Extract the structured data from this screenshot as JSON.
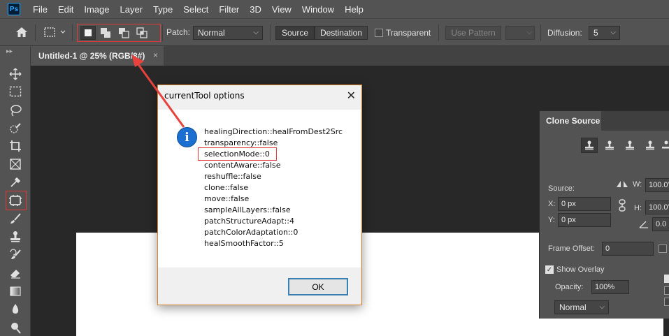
{
  "app": {
    "logo_text": "Ps"
  },
  "menu": [
    "File",
    "Edit",
    "Image",
    "Layer",
    "Type",
    "Select",
    "Filter",
    "3D",
    "View",
    "Window",
    "Help"
  ],
  "options_bar": {
    "patch_label": "Patch:",
    "patch_value": "Normal",
    "source_label": "Source",
    "destination_label": "Destination",
    "transparent_label": "Transparent",
    "transparent_checked": false,
    "use_pattern_label": "Use Pattern",
    "diffusion_label": "Diffusion:",
    "diffusion_value": "5",
    "active_selection_mode": "new-selection"
  },
  "document": {
    "tab_title": "Untitled-1 @ 25% (RGB/8#)",
    "close_glyph": "×"
  },
  "dialog": {
    "title": "currentTool options",
    "close_glyph": "✕",
    "icon_glyph": "i",
    "lines": [
      "healingDirection::healFromDest2Src",
      "transparency::false",
      "selectionMode::0",
      "contentAware::false",
      "reshuffle::false",
      "clone::false",
      "move::false",
      "sampleAllLayers::false",
      "patchStructureAdapt::4",
      "patchColorAdaptation::0",
      "healSmoothFactor::5"
    ],
    "ok_label": "OK"
  },
  "clone_panel": {
    "title": "Clone Source",
    "source_label": "Source:",
    "x_label": "X:",
    "x_value": "0 px",
    "y_label": "Y:",
    "y_value": "0 px",
    "w_label": "W:",
    "w_value": "100.0°",
    "h_label": "H:",
    "h_value": "100.0°",
    "angle_value": "0.0",
    "frame_offset_label": "Frame Offset:",
    "frame_offset_value": "0",
    "show_overlay_label": "Show Overlay",
    "show_overlay_checked": true,
    "opacity_label": "Opacity:",
    "opacity_value": "100%",
    "blend_mode": "Normal"
  },
  "colors": {
    "accent_red": "#e03a3a",
    "ps_blue": "#31a8ff",
    "info_blue": "#1a6fd0"
  }
}
